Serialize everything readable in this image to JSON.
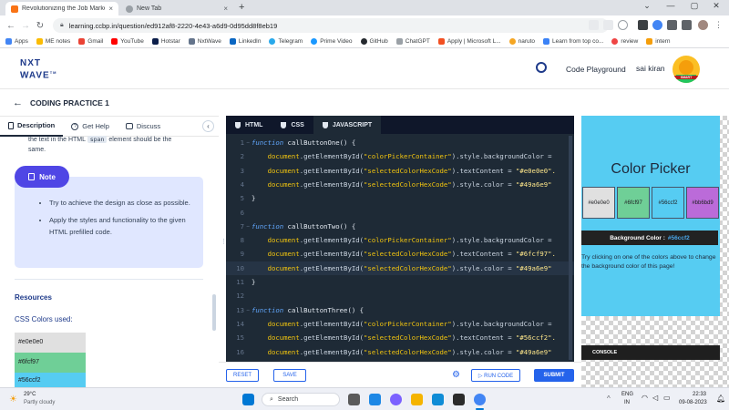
{
  "browser": {
    "tabs": [
      {
        "title": "Revolutionizing the Job Market |",
        "close": "×"
      },
      {
        "title": "New Tab",
        "close": "×"
      }
    ],
    "new_tab": "+",
    "url": "learning.ccbp.in/question/ed912af8-2220-4e43-a6d9-0d95dd8f8eb19",
    "window_controls": [
      "⌄",
      "—",
      "▢",
      "✕"
    ],
    "bookmarks": [
      "Apps",
      "ME notes",
      "Gmail",
      "YouTube",
      "Hotstar",
      "NxtWave",
      "LinkedIn",
      "Telegram",
      "Prime Video",
      "GitHub",
      "ChatGPT",
      "Apply | Microsoft L...",
      "naruto",
      "Learn from top co...",
      "review",
      "intern"
    ]
  },
  "site": {
    "logo_line1": "NXT",
    "logo_line2": "WAVE",
    "logo_tm": "TM",
    "code_playground": "Code Playground",
    "user_name": "sai kiran",
    "avatar_badge": "SMART"
  },
  "practice": {
    "back_arrow": "←",
    "title": "CODING PRACTICE 1"
  },
  "left": {
    "tabs": [
      "Description",
      "Get Help",
      "Discuss"
    ],
    "collapse": "‹",
    "partial_text": "the text in the HTML",
    "partial_code": "span",
    "partial_text2": "element should be the",
    "partial_text3": "same.",
    "note_label": "Note",
    "note_items": [
      "Try to achieve the design as close as possible.",
      "Apply the styles and functionality to the given HTML prefilled code."
    ],
    "resources_heading": "Resources",
    "css_colors_heading": "CSS Colors used:",
    "colors": [
      {
        "label": "#e0e0e0",
        "color": "#e0e0e0"
      },
      {
        "label": "#6fcf97",
        "color": "#6fcf97"
      },
      {
        "label": "#56ccf2",
        "color": "#56ccf2"
      }
    ]
  },
  "editor": {
    "tabs": [
      "HTML",
      "CSS",
      "JAVASCRIPT"
    ],
    "active_tab": "JAVASCRIPT",
    "lines": [
      {
        "n": "1",
        "fold": "−",
        "kw": "function",
        "rest": " callButtonOne() {"
      },
      {
        "n": "2",
        "indent": "    ",
        "doc": "document",
        "mid": ".getElementById(",
        "str": "\"colorPickerContainer\"",
        "tail": ").style.backgroundColor ="
      },
      {
        "n": "3",
        "indent": "    ",
        "doc": "document",
        "mid": ".getElementById(",
        "str": "\"selectedColorHexCode\"",
        "tail": ").textContent = ",
        "str2": "\"#e0e0e0\"."
      },
      {
        "n": "4",
        "indent": "    ",
        "doc": "document",
        "mid": ".getElementById(",
        "str": "\"selectedColorHexCode\"",
        "tail": ").style.color = ",
        "str2": "\"#49a6e9\""
      },
      {
        "n": "5",
        "rest": "}"
      },
      {
        "n": "6",
        "rest": ""
      },
      {
        "n": "7",
        "fold": "−",
        "kw": "function",
        "rest": " callButtonTwo() {"
      },
      {
        "n": "8",
        "indent": "    ",
        "doc": "document",
        "mid": ".getElementById(",
        "str": "\"colorPickerContainer\"",
        "tail": ").style.backgroundColor ="
      },
      {
        "n": "9",
        "indent": "    ",
        "doc": "document",
        "mid": ".getElementById(",
        "str": "\"selectedColorHexCode\"",
        "tail": ").textContent = ",
        "str2": "\"#6fcf97\"."
      },
      {
        "n": "10",
        "indent": "    ",
        "doc": "document",
        "mid": ".getElementById(",
        "str": "\"selectedColorHexCode\"",
        "tail": ").style.color = ",
        "str2": "\"#49a6e9\""
      },
      {
        "n": "11",
        "rest": "}"
      },
      {
        "n": "12",
        "rest": ""
      },
      {
        "n": "13",
        "fold": "−",
        "kw": "function",
        "rest": " callButtonThree() {"
      },
      {
        "n": "14",
        "indent": "    ",
        "doc": "document",
        "mid": ".getElementById(",
        "str": "\"colorPickerContainer\"",
        "tail": ").style.backgroundColor ="
      },
      {
        "n": "15",
        "indent": "    ",
        "doc": "document",
        "mid": ".getElementById(",
        "str": "\"selectedColorHexCode\"",
        "tail": ").textContent = ",
        "str2": "\"#56ccf2\"."
      },
      {
        "n": "16",
        "indent": "    ",
        "doc": "document",
        "mid": ".getElementById(",
        "str": "\"selectedColorHexCode\"",
        "tail": ").style.color = ",
        "str2": "\"#49a6e9\""
      },
      {
        "n": "17",
        "rest": ""
      }
    ],
    "active_line": "10",
    "reset": "RESET",
    "save": "SAVE",
    "run_code": "▷ RUN CODE",
    "submit": "SUBMIT"
  },
  "preview": {
    "title": "Color Picker",
    "bg_color": "#56ccf2",
    "buttons": [
      {
        "label": "#e0e0e0",
        "color": "#e0e0e0"
      },
      {
        "label": "#6fcf97",
        "color": "#6fcf97"
      },
      {
        "label": "#56ccf2",
        "color": "#56ccf2"
      },
      {
        "label": "#bb6bd9",
        "color": "#bb6bd9"
      }
    ],
    "bg_label": "Background Color :",
    "bg_value": "#56ccf2",
    "instruction": "Try clicking on one of the colors above to change the background color of this page!",
    "console": "CONSOLE"
  },
  "taskbar": {
    "temp": "29°C",
    "weather": "Partly cloudy",
    "search": "Search",
    "lang1": "ENG",
    "lang2": "IN",
    "time": "22:33",
    "date": "09-08-2023"
  },
  "colors": {
    "accent": "#2563eb",
    "note_bg": "#e0e7ff",
    "note_badge": "#4f46e5",
    "editor_bg": "#1e2a36"
  }
}
